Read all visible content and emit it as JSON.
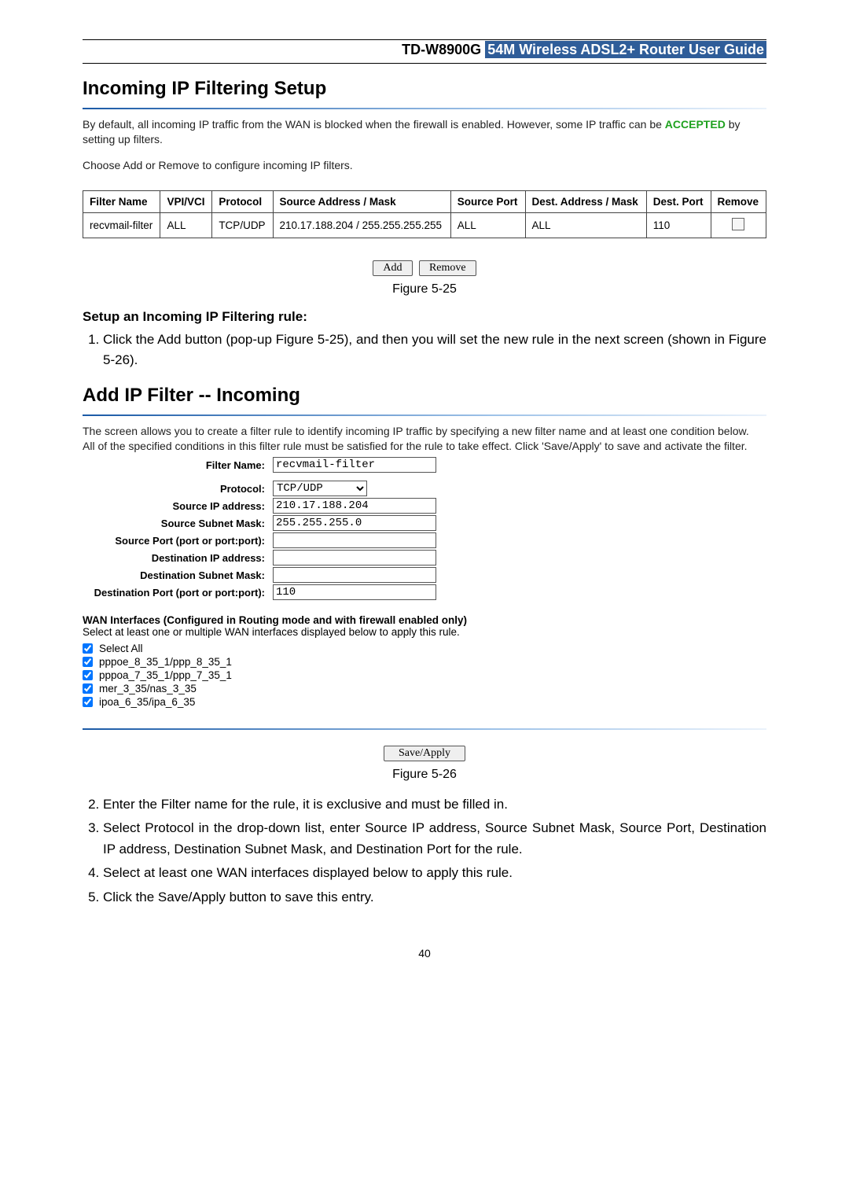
{
  "header": {
    "model": "TD-W8900G",
    "title": "54M Wireless ADSL2+ Router User Guide"
  },
  "fig25": {
    "title": "Incoming IP Filtering Setup",
    "intro_pre": "By default, all incoming IP traffic from the WAN is blocked when the firewall is enabled. However, some IP traffic can be ",
    "intro_accepted": "ACCEPTED",
    "intro_post": " by setting up filters.",
    "line2": "Choose Add or Remove to configure incoming IP filters.",
    "headers": {
      "c1": "Filter Name",
      "c2": "VPI/VCI",
      "c3": "Protocol",
      "c4": "Source Address / Mask",
      "c5": "Source Port",
      "c6": "Dest. Address / Mask",
      "c7": "Dest. Port",
      "c8": "Remove"
    },
    "row": {
      "c1": "recvmail-filter",
      "c2": "ALL",
      "c3": "TCP/UDP",
      "c4": "210.17.188.204 / 255.255.255.255",
      "c5": "ALL",
      "c6": "ALL",
      "c7": "110"
    },
    "btn_add": "Add",
    "btn_remove": "Remove",
    "caption": "Figure 5-25"
  },
  "setup_heading": "Setup an Incoming IP Filtering rule:",
  "step1": {
    "pre": "Click the ",
    "bold": "Add",
    "post": " button (pop-up Figure 5-25), and then you will set the new rule in the next screen (shown in Figure 5-26)."
  },
  "fig26": {
    "title": "Add IP Filter -- Incoming",
    "desc1": "The screen allows you to create a filter rule to identify incoming IP traffic by specifying a new filter name and at least one condition below.",
    "desc2": "All of the specified conditions in this filter rule must be satisfied for the rule to take effect. Click 'Save/Apply' to save and activate the filter.",
    "labels": {
      "filter_name": "Filter Name:",
      "protocol": "Protocol:",
      "src_ip": "Source IP address:",
      "src_mask": "Source Subnet Mask:",
      "src_port": "Source Port (port or port:port):",
      "dst_ip": "Destination IP address:",
      "dst_mask": "Destination Subnet Mask:",
      "dst_port": "Destination Port (port or port:port):"
    },
    "values": {
      "filter_name": "recvmail-filter",
      "protocol": "TCP/UDP",
      "src_ip": "210.17.188.204",
      "src_mask": "255.255.255.0",
      "src_port": "",
      "dst_ip": "",
      "dst_mask": "",
      "dst_port": "110"
    },
    "wan_title": "WAN Interfaces (Configured in Routing mode and with firewall enabled only)",
    "wan_desc": "Select at least one or multiple WAN interfaces displayed below to apply this rule.",
    "interfaces": [
      "Select All",
      "pppoe_8_35_1/ppp_8_35_1",
      "pppoa_7_35_1/ppp_7_35_1",
      "mer_3_35/nas_3_35",
      "ipoa_6_35/ipa_6_35"
    ],
    "btn_save": "Save/Apply",
    "caption": "Figure 5-26"
  },
  "steps_tail": {
    "s2_pre": "Enter the ",
    "s2_b": "Filter name",
    "s2_post": " for the rule, it is exclusive and must be filled in.",
    "s3_pre": "Select ",
    "s3_b1": "Protocol",
    "s3_mid1": " in the drop-down list, enter ",
    "s3_b2": "Source IP address",
    "s3_c1": ", ",
    "s3_b3": "Source Subnet Mask",
    "s3_c2": ", ",
    "s3_b4": "Source Port",
    "s3_c3": ", ",
    "s3_b5": "Destination IP address",
    "s3_c4": ", ",
    "s3_b6": "Destination Subnet Mask",
    "s3_c5": ", and ",
    "s3_b7": "Destination Port",
    "s3_post": " for the rule.",
    "s4": "Select at least one WAN interfaces displayed below to apply this rule.",
    "s5_pre": "Click the ",
    "s5_b": "Save/Apply",
    "s5_post": " button to save this entry."
  },
  "page_number": "40"
}
